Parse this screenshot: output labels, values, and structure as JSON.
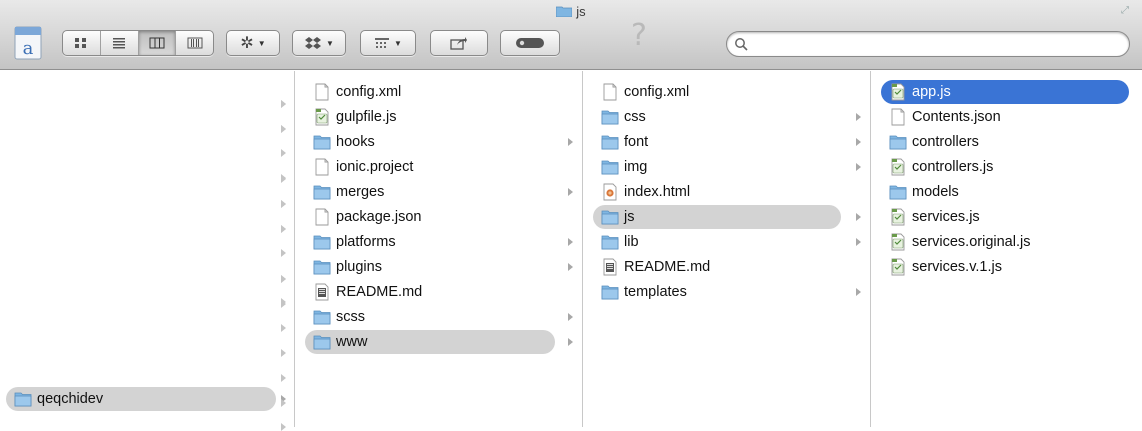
{
  "window": {
    "title": "js"
  },
  "search": {
    "value": "",
    "placeholder": ""
  },
  "toolbar": {
    "help_glyph": "?",
    "view_modes": [
      "icon",
      "list",
      "column",
      "coverflow"
    ],
    "selected_view": "column"
  },
  "colors": {
    "selection_blue": "#3a74d5",
    "selection_gray": "#d3d3d3",
    "folder_blue": "#7fb6e2"
  },
  "columns": [
    {
      "items": [
        {
          "name": "qeqchidev",
          "kind": "folder",
          "state": "path"
        }
      ]
    },
    {
      "items": [
        {
          "name": "config.xml",
          "kind": "file"
        },
        {
          "name": "gulpfile.js",
          "kind": "js"
        },
        {
          "name": "hooks",
          "kind": "folder"
        },
        {
          "name": "ionic.project",
          "kind": "file"
        },
        {
          "name": "merges",
          "kind": "folder"
        },
        {
          "name": "package.json",
          "kind": "file"
        },
        {
          "name": "platforms",
          "kind": "folder"
        },
        {
          "name": "plugins",
          "kind": "folder"
        },
        {
          "name": "README.md",
          "kind": "doc"
        },
        {
          "name": "scss",
          "kind": "folder"
        },
        {
          "name": "www",
          "kind": "folder",
          "state": "path"
        }
      ]
    },
    {
      "items": [
        {
          "name": "config.xml",
          "kind": "file"
        },
        {
          "name": "css",
          "kind": "folder"
        },
        {
          "name": "font",
          "kind": "folder"
        },
        {
          "name": "img",
          "kind": "folder"
        },
        {
          "name": "index.html",
          "kind": "html"
        },
        {
          "name": "js",
          "kind": "folder",
          "state": "path"
        },
        {
          "name": "lib",
          "kind": "folder"
        },
        {
          "name": "README.md",
          "kind": "doc"
        },
        {
          "name": "templates",
          "kind": "folder"
        }
      ]
    },
    {
      "items": [
        {
          "name": "app.js",
          "kind": "js",
          "state": "selected"
        },
        {
          "name": "Contents.json",
          "kind": "file"
        },
        {
          "name": "controllers",
          "kind": "folder"
        },
        {
          "name": "controllers.js",
          "kind": "js"
        },
        {
          "name": "models",
          "kind": "folder"
        },
        {
          "name": "services.js",
          "kind": "js"
        },
        {
          "name": "services.original.js",
          "kind": "js"
        },
        {
          "name": "services.v.1.js",
          "kind": "js"
        }
      ]
    }
  ]
}
